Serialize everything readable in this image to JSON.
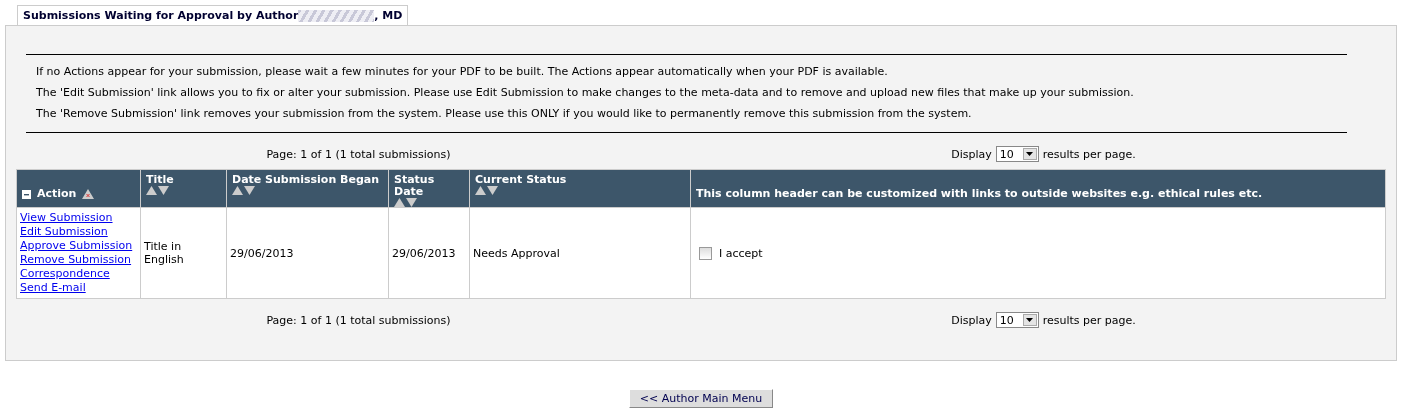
{
  "tab": {
    "title": "Submissions Waiting for Approval by Author",
    "suffix": ", MD",
    "selected": true
  },
  "notes": [
    "If no Actions appear for your submission, please wait a few minutes for your PDF to be built. The Actions appear automatically when your PDF is available.",
    "The 'Edit Submission' link allows you to fix or alter your submission. Please use Edit Submission to make changes to the meta-data and to remove and upload new files that make up your submission.",
    "The 'Remove Submission' link removes your submission from the system. Please use this ONLY if you would like to permanently remove this submission from the system."
  ],
  "pager_top": {
    "page": "Page: 1 of 1 (1 total submissions)",
    "display": "Display",
    "per_page": "10",
    "suffix": "results per page."
  },
  "table": {
    "columns": [
      {
        "label": "Action",
        "kind": "action"
      },
      {
        "label": "Title",
        "kind": "sort"
      },
      {
        "label": "Date Submission Began",
        "kind": "sort"
      },
      {
        "label": "Status Date",
        "kind": "sort"
      },
      {
        "label": "Current Status",
        "kind": "sort"
      },
      {
        "label": "This column header can be customized with links to outside websites e.g. ethical rules etc.",
        "kind": "plain"
      }
    ],
    "rows": [
      {
        "actions": [
          "View Submission",
          "Edit Submission",
          "Approve Submission",
          "Remove Submission",
          "Correspondence",
          "Send E-mail"
        ],
        "title": "Title in English",
        "began": "29/06/2013",
        "status_date": "29/06/2013",
        "status": "Needs Approval",
        "accept": {
          "label": "I accept",
          "checked": false
        }
      }
    ]
  },
  "pager_bottom": {
    "page": "Page: 1 of 1 (1 total submissions)",
    "display": "Display",
    "per_page": "10",
    "suffix": "results per page."
  },
  "back_button": "<< Author Main Menu"
}
